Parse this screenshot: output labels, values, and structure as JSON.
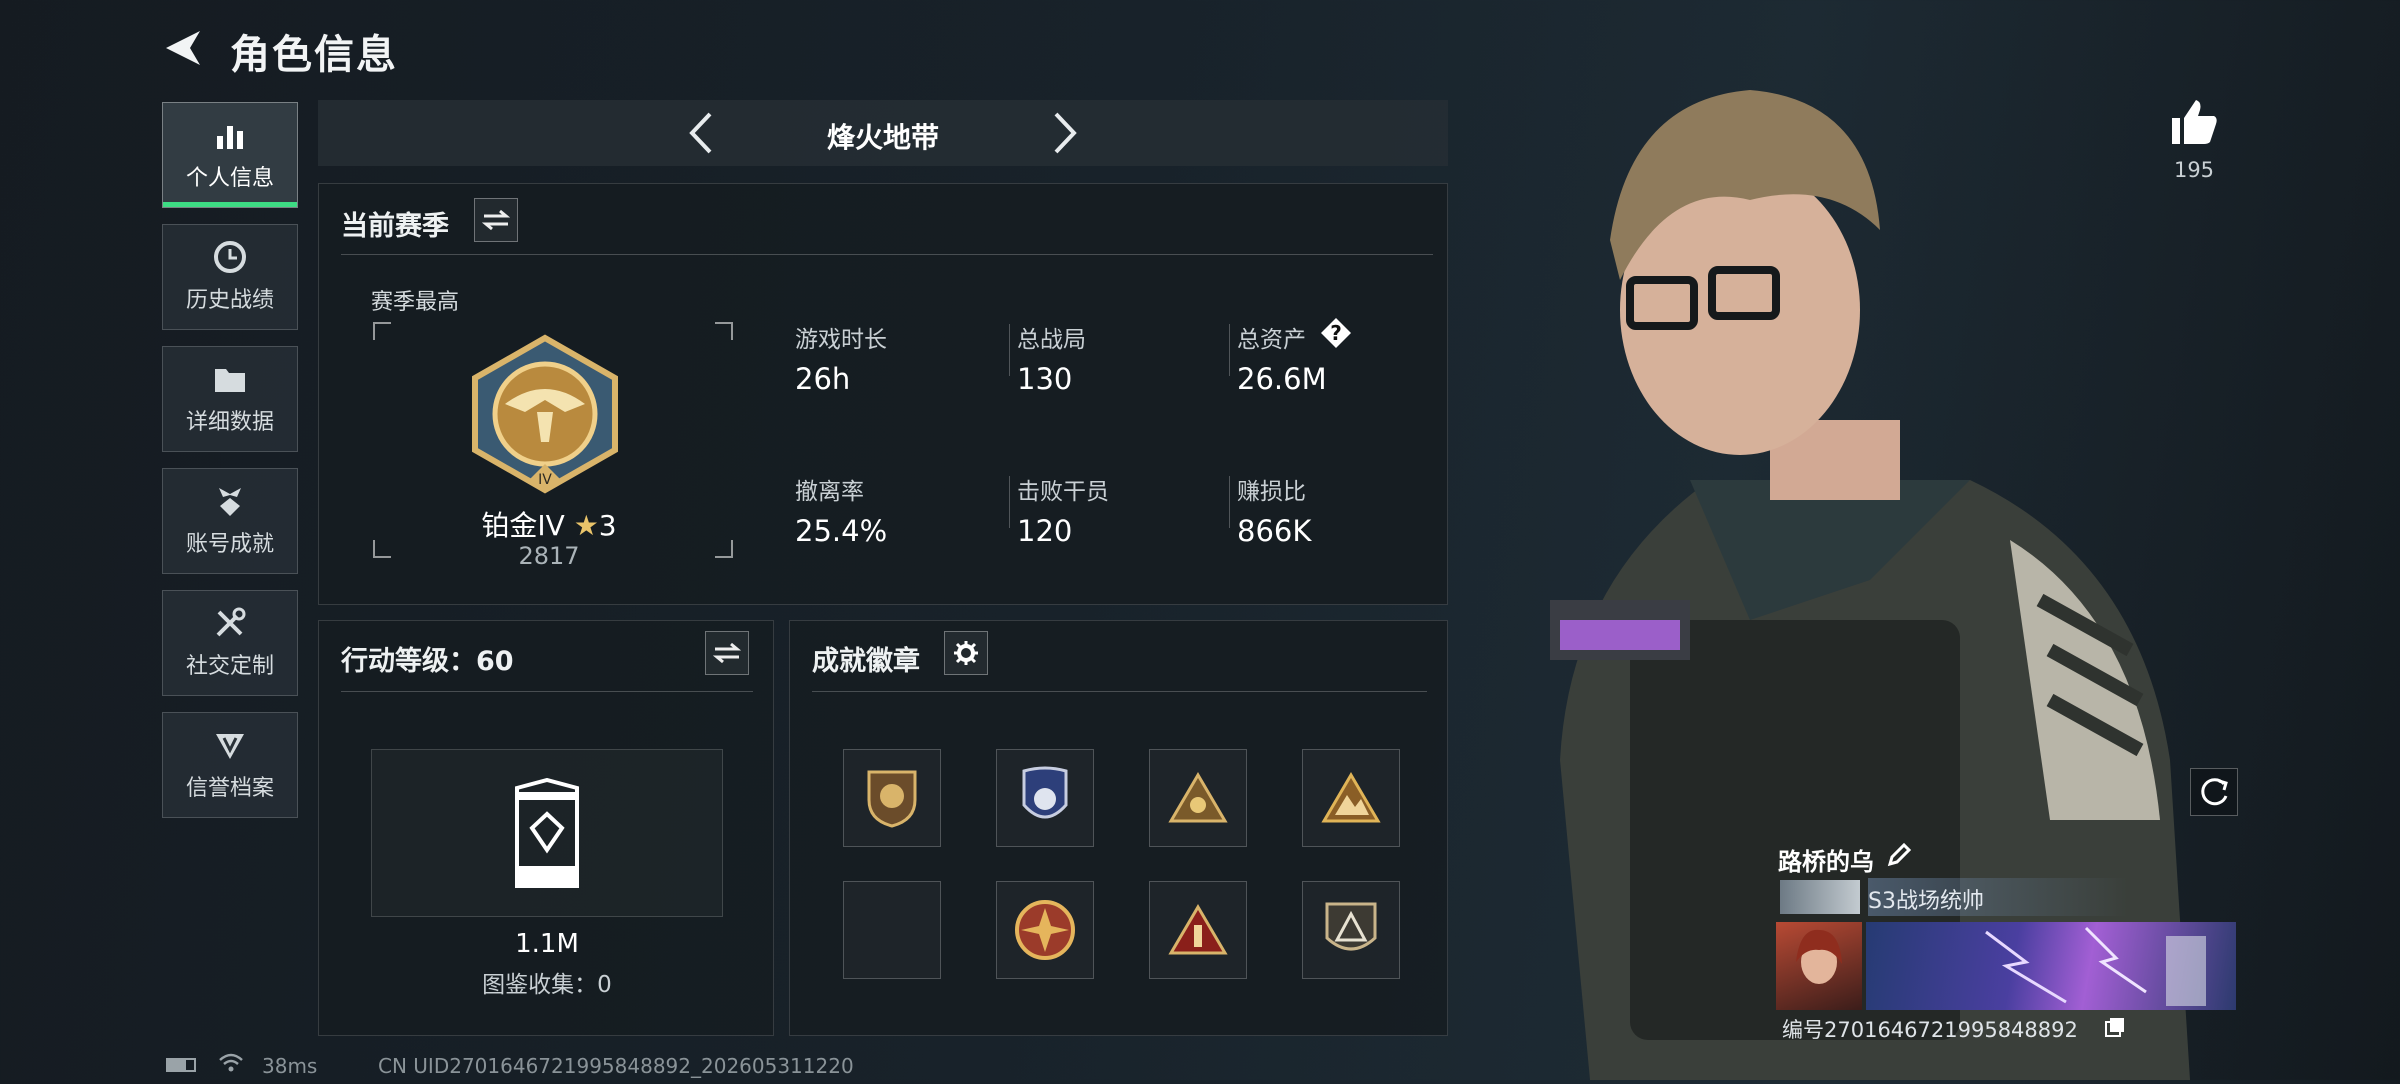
{
  "header": {
    "title": "角色信息"
  },
  "sidebar": {
    "items": [
      {
        "label": "个人信息"
      },
      {
        "label": "历史战绩"
      },
      {
        "label": "详细数据"
      },
      {
        "label": "账号成就"
      },
      {
        "label": "社交定制"
      },
      {
        "label": "信誉档案"
      }
    ]
  },
  "mode": {
    "name": "烽火地带"
  },
  "season": {
    "title": "当前赛季",
    "best_label": "赛季最高",
    "rank_name": "铂金IV",
    "rank_stars": "3",
    "rank_score": "2817",
    "stats": [
      {
        "label": "游戏时长",
        "value": "26h"
      },
      {
        "label": "总战局",
        "value": "130"
      },
      {
        "label": "总资产",
        "value": "26.6M"
      },
      {
        "label": "撤离率",
        "value": "25.4%"
      },
      {
        "label": "击败干员",
        "value": "120"
      },
      {
        "label": "赚损比",
        "value": "866K"
      }
    ],
    "help_glyph": "?"
  },
  "action_level": {
    "title": "行动等级：60",
    "value": "1.1M",
    "collection": "图鉴收集：0"
  },
  "badges": {
    "title": "成就徽章"
  },
  "likes": {
    "count": "195"
  },
  "profile": {
    "name": "路桥的乌",
    "title": "S3战场统帅",
    "id_text": "编号2701646721995848892"
  },
  "status": {
    "ping": "38ms",
    "uid": "CN UID2701646721995848892_202605311220"
  },
  "colors": {
    "accent": "#3ddc84",
    "gold": "#d9b46a"
  }
}
